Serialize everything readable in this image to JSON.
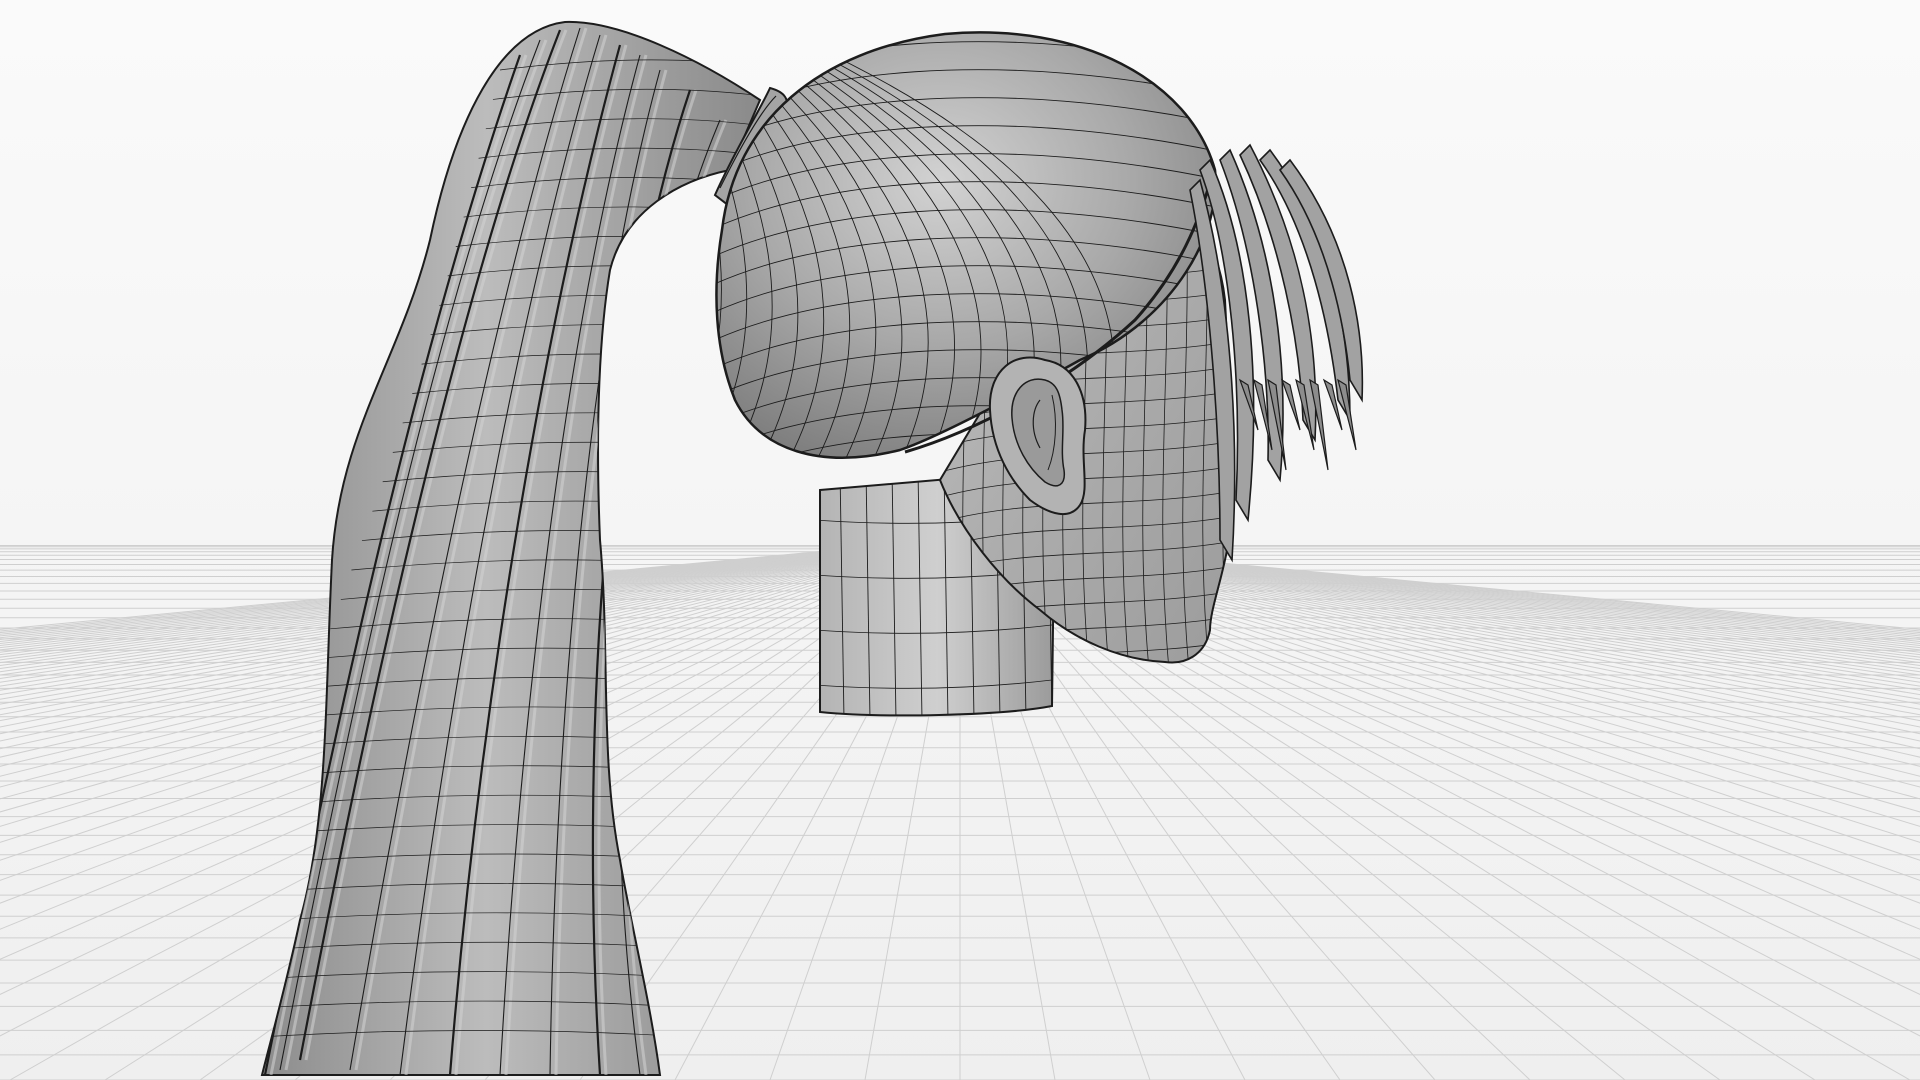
{
  "viewport": {
    "mode": "wireframe-on-shaded",
    "background_color": "#f4f4f4",
    "floor_grid": "on",
    "grid_line_color": "#cfcfcf",
    "mesh_fill_color": "#9e9e9e",
    "mesh_highlight_color": "#c8c8c8",
    "wire_color": "#1c1c1c"
  },
  "scene": {
    "objects": [
      {
        "name": "head-mesh",
        "label": ""
      },
      {
        "name": "ponytail-hair-mesh",
        "label": ""
      },
      {
        "name": "bangs-hair-mesh",
        "label": ""
      },
      {
        "name": "ear-mesh",
        "label": ""
      }
    ]
  }
}
